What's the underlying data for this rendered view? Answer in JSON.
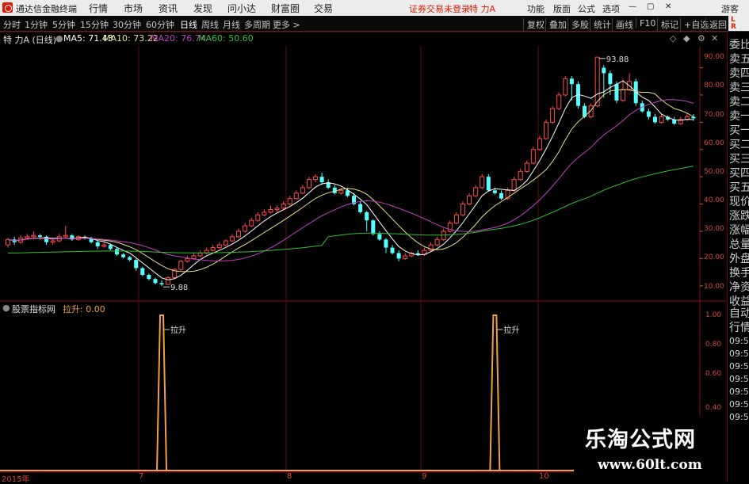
{
  "window": {
    "app_title": "通达信金融终端",
    "menu": [
      "行情",
      "市场",
      "资讯",
      "发现",
      "问小达",
      "财富圈",
      "交易"
    ],
    "alert": "证券交易未登录",
    "stock_title": "特 力A",
    "right_menu": [
      "功能",
      "版面",
      "公式",
      "选项"
    ],
    "guest": "游客",
    "badge_line1": "L",
    "badge_line2": "R"
  },
  "toolbar": {
    "periods": [
      "分时",
      "1分钟",
      "5分钟",
      "15分钟",
      "30分钟",
      "60分钟",
      "日线",
      "周线",
      "月线",
      "多周期",
      "更多 >"
    ],
    "active_period": "日线",
    "buttons": [
      "复权",
      "叠加",
      "多股",
      "统计",
      "画线",
      "F10",
      "标记",
      "+自选",
      "返回"
    ]
  },
  "info": {
    "stock": "特 力A (日线)",
    "ma5": "MA5: 71.43",
    "ma10": "MA10: 73.22",
    "ma20": "MA20: 76.74",
    "ma60": "MA60: 50.60"
  },
  "indicator": {
    "name": "股票指标网",
    "value": "拉升: 0.00",
    "marker_label": "拉升"
  },
  "side_panel": {
    "items": [
      "委比",
      "卖五",
      "卖四",
      "卖三",
      "卖二",
      "卖一",
      "买一",
      "买二",
      "买三",
      "买四",
      "买五",
      "现价",
      "涨跌",
      "涨幅",
      "总量",
      "外盘",
      "换手",
      "净资",
      "收益"
    ],
    "items2": [
      "自动",
      "行情"
    ],
    "times": [
      "09:51",
      "09:51",
      "09:52",
      "09:52",
      "09:52",
      "09:52",
      "09:52"
    ]
  },
  "price_axis": [
    "90.00",
    "80.00",
    "70.00",
    "60.00",
    "50.00",
    "40.00",
    "30.00",
    "20.00",
    "10.00"
  ],
  "ind_axis": [
    "1.00",
    "0.80",
    "0.60",
    "0.40"
  ],
  "dates": [
    "2015年",
    "7",
    "8",
    "9",
    "10"
  ],
  "annotations": {
    "high": "93.88",
    "low": "9.88"
  },
  "watermark": {
    "line1": "乐淘公式网",
    "line2": "www.60lt.com"
  },
  "colors": {
    "up": "#ff4a4a",
    "down": "#54ffff",
    "ma5": "#ffffff",
    "ma10": "#e8e08a",
    "ma20": "#c040c0",
    "ma60": "#30c030",
    "signal": "#f0a040",
    "axis": "#d7483a"
  },
  "chart_data": {
    "type": "candlestick",
    "price_range": [
      5,
      98
    ],
    "candles": [
      [
        25,
        27,
        24,
        27.5
      ],
      [
        27,
        26,
        25,
        28
      ],
      [
        26,
        27.5,
        25.5,
        28.5
      ],
      [
        27.5,
        28,
        27,
        29
      ],
      [
        28,
        28.5,
        27,
        30
      ],
      [
        28.5,
        28,
        27,
        29
      ],
      [
        28,
        26,
        25,
        28.5
      ],
      [
        26,
        26.5,
        25,
        27
      ],
      [
        26.5,
        28,
        26,
        29
      ],
      [
        28,
        28.5,
        27.5,
        32
      ],
      [
        28.5,
        27,
        26.5,
        29
      ],
      [
        27,
        28,
        26.5,
        28.5
      ],
      [
        28,
        27.5,
        27,
        28.5
      ],
      [
        27.5,
        26,
        25.5,
        28
      ],
      [
        26,
        24.5,
        23.5,
        26.5
      ],
      [
        24.5,
        25,
        24,
        26
      ],
      [
        25,
        23.5,
        23,
        25.5
      ],
      [
        23.5,
        21.5,
        21,
        24
      ],
      [
        21.5,
        20.5,
        20,
        22
      ],
      [
        20.5,
        19.5,
        19,
        21
      ],
      [
        19.5,
        16.5,
        15.5,
        20
      ],
      [
        16.5,
        14,
        13.5,
        17
      ],
      [
        14,
        12.5,
        12,
        14.5
      ],
      [
        12.5,
        11,
        10.5,
        13
      ],
      [
        11,
        10.5,
        9.88,
        12
      ],
      [
        10.5,
        13,
        10.5,
        13.5
      ],
      [
        13,
        16,
        13,
        16.5
      ],
      [
        16,
        19,
        15.5,
        19.5
      ],
      [
        19,
        20,
        18.5,
        21
      ],
      [
        20,
        21,
        19.5,
        22
      ],
      [
        21,
        22,
        20.5,
        23
      ],
      [
        22,
        23,
        21.5,
        24
      ],
      [
        23,
        24,
        22.5,
        25
      ],
      [
        24,
        25,
        23.5,
        26
      ],
      [
        25,
        26.5,
        24.5,
        27
      ],
      [
        26.5,
        28,
        26,
        29
      ],
      [
        28,
        30,
        27.5,
        31
      ],
      [
        30,
        32,
        29.5,
        33
      ],
      [
        32,
        34,
        31.5,
        35
      ],
      [
        34,
        36,
        33.5,
        37
      ],
      [
        36,
        37,
        35.5,
        38
      ],
      [
        37,
        38,
        36.5,
        39.5
      ],
      [
        38,
        38.5,
        37,
        39.5
      ],
      [
        38.5,
        40,
        38,
        41
      ],
      [
        40,
        42,
        39.5,
        43
      ],
      [
        42,
        44,
        41.5,
        45
      ],
      [
        44,
        46,
        43.5,
        47
      ],
      [
        46,
        49,
        45.5,
        50
      ],
      [
        49,
        50,
        48,
        51
      ],
      [
        50,
        48,
        47,
        51.5
      ],
      [
        48,
        46,
        45.5,
        49
      ],
      [
        46,
        44,
        43.5,
        47
      ],
      [
        44,
        45,
        43.5,
        46
      ],
      [
        45,
        43,
        42.5,
        46
      ],
      [
        43,
        40,
        39.5,
        44
      ],
      [
        40,
        37,
        36.5,
        41
      ],
      [
        37,
        34,
        30,
        37.5
      ],
      [
        34,
        29,
        28.5,
        34.5
      ],
      [
        29,
        27,
        26.5,
        30
      ],
      [
        27,
        24,
        22,
        27.5
      ],
      [
        24,
        22,
        21.5,
        25
      ],
      [
        22,
        20,
        19,
        23
      ],
      [
        20,
        21,
        19.5,
        22
      ],
      [
        21,
        22,
        20.5,
        22.5
      ],
      [
        22,
        21.5,
        21,
        23
      ],
      [
        21.5,
        23,
        21,
        24
      ],
      [
        23,
        25,
        22.5,
        26
      ],
      [
        25,
        27,
        24.5,
        28
      ],
      [
        27,
        30,
        26.5,
        31
      ],
      [
        30,
        33,
        29.5,
        34
      ],
      [
        33,
        36,
        32.5,
        37
      ],
      [
        36,
        40,
        35.5,
        41
      ],
      [
        40,
        43,
        39.5,
        44
      ],
      [
        43,
        46,
        42.5,
        47
      ],
      [
        46,
        50,
        45.5,
        51
      ],
      [
        50,
        45,
        44.5,
        51
      ],
      [
        45,
        44,
        43.5,
        46
      ],
      [
        44,
        42,
        41.5,
        45
      ],
      [
        42,
        45,
        41.5,
        46
      ],
      [
        45,
        49,
        44.5,
        50
      ],
      [
        49,
        52,
        48.5,
        53
      ],
      [
        52,
        55,
        51.5,
        56
      ],
      [
        55,
        60,
        54.5,
        61
      ],
      [
        60,
        64,
        59.5,
        65
      ],
      [
        64,
        70,
        63.5,
        71
      ],
      [
        70,
        75,
        69.5,
        76
      ],
      [
        75,
        80,
        74.5,
        81
      ],
      [
        80,
        86,
        79.5,
        87
      ],
      [
        86,
        84,
        78,
        87
      ],
      [
        84,
        76,
        75,
        85
      ],
      [
        76,
        72,
        71.5,
        77
      ],
      [
        72,
        76,
        71.5,
        77
      ],
      [
        76,
        93.88,
        75.5,
        94
      ],
      [
        90,
        88,
        79,
        91
      ],
      [
        88,
        84,
        80,
        89
      ],
      [
        84,
        78,
        77,
        85
      ],
      [
        78,
        82,
        77.5,
        86
      ],
      [
        82,
        85,
        81.5,
        88
      ],
      [
        85,
        77,
        76,
        86
      ],
      [
        77,
        74,
        73.5,
        78
      ],
      [
        74,
        72,
        71,
        75
      ],
      [
        72,
        70,
        69.5,
        73
      ],
      [
        70,
        72,
        69.5,
        73
      ],
      [
        72,
        71,
        70.5,
        72.5
      ],
      [
        71,
        69.5,
        69,
        72
      ],
      [
        69.5,
        71,
        69,
        72
      ],
      [
        71,
        72,
        70.5,
        73.5
      ],
      [
        72,
        71.43,
        70.5,
        73
      ]
    ],
    "signals_at_index": [
      24,
      76
    ]
  }
}
